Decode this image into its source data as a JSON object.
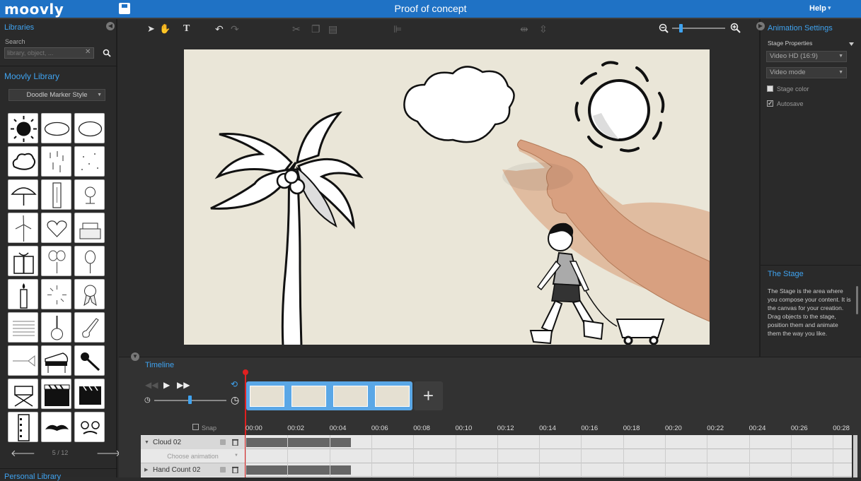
{
  "app": {
    "logo": "moovly",
    "title": "Proof of concept",
    "help": "Help",
    "help_caret": "▾"
  },
  "left_panel": {
    "libraries_heading": "Libraries",
    "search_label": "Search",
    "search_placeholder": "library, object, ...",
    "moovly_library_heading": "Moovly Library",
    "style_select": "Doodle Marker Style",
    "pager": "5 / 12",
    "personal_library_heading": "Personal Library"
  },
  "right_panel": {
    "animation_settings": "Animation Settings",
    "stage_properties": "Stage Properties",
    "format_select": "Video HD (16:9)",
    "mode_select": "Video mode",
    "stage_color_label": "Stage color",
    "autosave_label": "Autosave",
    "autosave_checked": true,
    "help_title": "The Stage",
    "help_text": "The Stage is the area where you compose your content. It is the canvas for your creation. Drag objects to the stage, position them and animate them the way you like."
  },
  "timeline": {
    "heading": "Timeline",
    "snap_label": "Snap",
    "snap_checked": true,
    "ticks": [
      "00:00",
      "00:02",
      "00:04",
      "00:06",
      "00:08",
      "00:10",
      "00:12",
      "00:14",
      "00:16",
      "00:18",
      "00:20",
      "00:22",
      "00:24",
      "00:26",
      "00:28"
    ],
    "tracks": [
      {
        "name": "Cloud 02",
        "expanded": true
      },
      {
        "name": "Hand Count 02",
        "expanded": false
      }
    ],
    "choose_animation": "Choose animation",
    "clip_count": 4,
    "speed_level": 0.5
  },
  "colors": {
    "accent": "#1f72c5",
    "heading_blue": "#3fa3f0",
    "playhead": "#e02020"
  }
}
